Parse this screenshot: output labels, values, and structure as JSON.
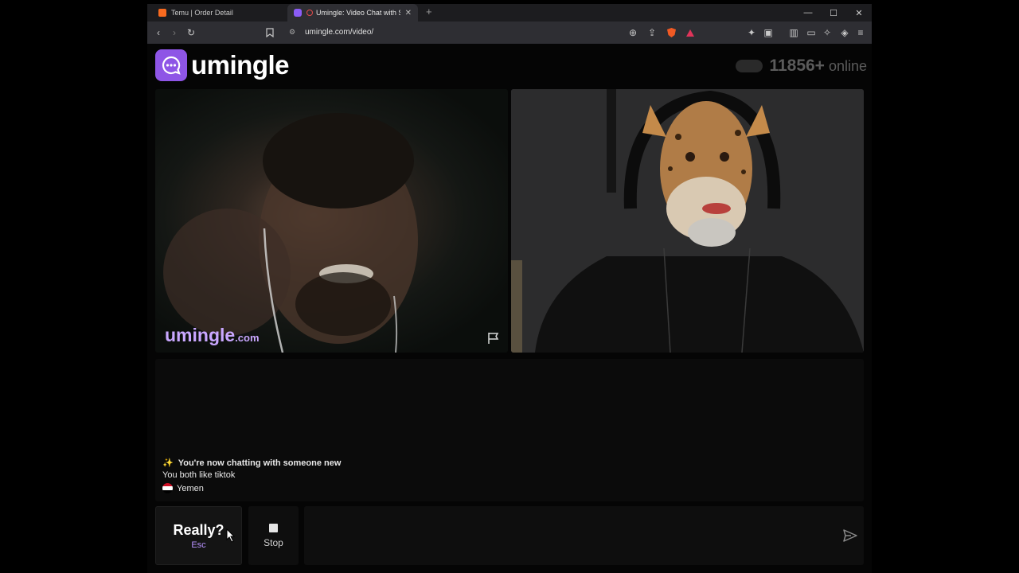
{
  "browser": {
    "tabs": [
      {
        "label": "Temu | Order Detail"
      },
      {
        "label": "Umingle: Video Chat with Stra"
      }
    ],
    "new_tab": "+",
    "url": "umingle.com/video/"
  },
  "header": {
    "logo_text": "umingle",
    "online_count": "11856+",
    "online_label": "online"
  },
  "video": {
    "watermark_name": "umingle",
    "watermark_domain": ".com"
  },
  "chat": {
    "new_chat_message": "You're now chatting with someone new",
    "shared_interest": "You both like tiktok",
    "country": "Yemen"
  },
  "controls": {
    "really_label": "Really?",
    "really_key": "Esc",
    "stop_label": "Stop",
    "message_placeholder": ""
  },
  "colors": {
    "brand": "#8e55e6",
    "accent_text": "#b892ff"
  }
}
